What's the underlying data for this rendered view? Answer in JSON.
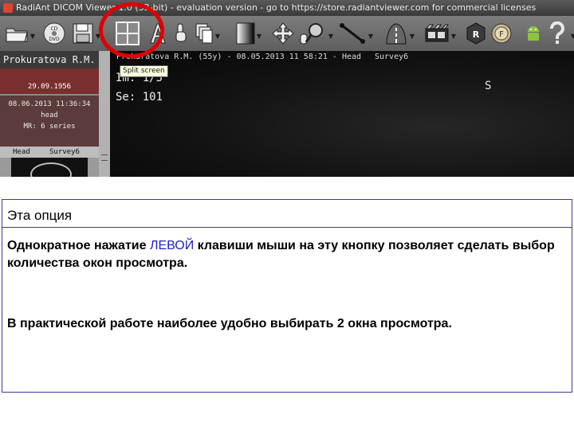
{
  "window": {
    "title": "RadiAnt DICOM Viewer 1.0 (32-bit) - evaluation version - go to https://store.radiantviewer.com for commercial licenses"
  },
  "toolbar": {
    "items": [
      {
        "name": "open-folder",
        "icon": "folder-icon"
      },
      {
        "name": "open-cd",
        "icon": "cd-dvd-icon",
        "label": "CD\nDVD"
      },
      {
        "name": "save",
        "icon": "floppy-icon"
      },
      {
        "name": "split-screen",
        "icon": "grid-2x2-icon"
      },
      {
        "name": "annotations",
        "icon": "text-a-icon"
      },
      {
        "name": "pan",
        "icon": "hand-icon"
      },
      {
        "name": "series-stack",
        "icon": "stack-icon"
      },
      {
        "name": "window-level",
        "icon": "contrast-icon"
      },
      {
        "name": "move",
        "icon": "move-arrows-icon"
      },
      {
        "name": "zoom",
        "icon": "magnifier-icon"
      },
      {
        "name": "measure",
        "icon": "ruler-line-icon"
      },
      {
        "name": "mpr",
        "icon": "road-icon"
      },
      {
        "name": "cine",
        "icon": "film-icon"
      },
      {
        "name": "reconstruct",
        "icon": "r-badge-icon"
      },
      {
        "name": "fusion",
        "icon": "f-badge-icon"
      },
      {
        "name": "android-export",
        "icon": "android-icon"
      },
      {
        "name": "help",
        "icon": "question-icon"
      }
    ],
    "split_tooltip": "Split screen",
    "annotation_color": "#e00000"
  },
  "patient": {
    "name": "Prokuratova R.M.",
    "birth_date": "29.09.1956",
    "study_datetime": "08.06.2013 11:36:34",
    "study_desc": "head",
    "series_count": "MR: 6 series",
    "series_label_1": "Head",
    "series_label_2": "Survey6"
  },
  "viewport": {
    "header_patient": "Prokuratova R.M. (55y) - 08.05.2013 11 58:21 - Head",
    "header_series": "Survey6",
    "image_index": "Im: 1/5",
    "series_index": "Se: 101",
    "orientation": "S"
  },
  "explanation": {
    "title": "Эта опция",
    "p1_before": "Однократное нажатие ",
    "p1_highlight": "ЛЕВОЙ",
    "p1_after": " клавиши мыши на эту кнопку позволяет сделать выбор количества окон просмотра.",
    "p2": "В практической работе наиболее удобно выбирать 2 окна просмотра."
  }
}
